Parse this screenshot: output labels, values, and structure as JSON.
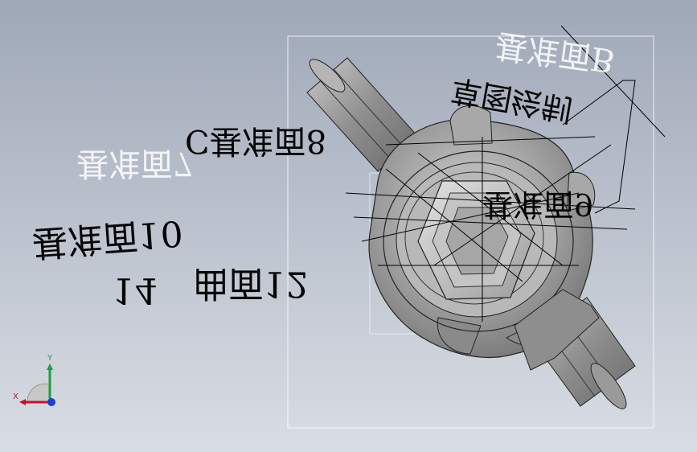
{
  "viewport": {
    "background_top": "#9fa8b8",
    "background_bottom": "#d9dde4"
  },
  "model": {
    "body_color": "#8c8c8c",
    "edge_color": "#1a1a1a",
    "bounding_box_color": "#ffffff"
  },
  "annotations": {
    "ghost_1": "基准面B",
    "ghost_2": "基准面7",
    "ink_1": "草图绘制",
    "ink_2": "C基准面8",
    "ink_3": "基准面9",
    "ink_4": "基准面10",
    "ink_5": "曲面12",
    "ink_6": "14"
  },
  "triad": {
    "x_label": "X",
    "y_label": "Y",
    "x_color": "#c8102e",
    "y_color": "#1e9e3a",
    "z_color": "#1a3fd6"
  }
}
